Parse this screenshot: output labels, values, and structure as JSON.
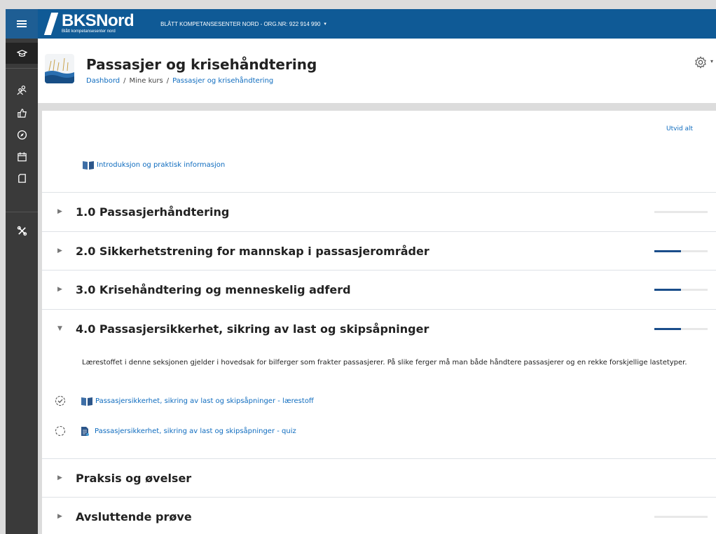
{
  "navbar": {
    "logo_main": "BKSNord",
    "logo_sub": "Blått kompetansesenter nord",
    "org_label": "BLÅTT KOMPETANSESENTER NORD - ORG.NR: 922 914 990",
    "org_caret": "▾"
  },
  "sidebar": {
    "icons": [
      "menu-icon",
      "course-icon",
      "participants-icon",
      "badges-icon",
      "competencies-icon",
      "calendar-icon",
      "files-icon",
      "tools-icon"
    ]
  },
  "header": {
    "title": "Passasjer og krisehåndtering",
    "breadcrumb": [
      "Dashbord",
      "Mine kurs",
      "Passasjer og krisehåndtering"
    ],
    "breadcrumb_sep": "/",
    "settings_caret": "▾"
  },
  "content": {
    "expand_all": "Utvid alt",
    "intro_link": "Introduksjon og praktisk informasjon",
    "sections": [
      {
        "title": "1.0 Passasjerhåndtering",
        "progress": 0,
        "caret": "▶"
      },
      {
        "title": "2.0 Sikkerhetstrening for mannskap i passasjerområder",
        "progress": 0.5,
        "caret": "▶"
      },
      {
        "title": "3.0 Krisehåndtering og menneskelig adferd",
        "progress": 0.5,
        "caret": "▶"
      },
      {
        "title": "4.0 Passasjersikkerhet, sikring av last og skipsåpninger",
        "progress": 0.5,
        "caret": "▼",
        "summary": "Lærestoffet i denne seksjonen gjelder i hovedsak for bilferger som frakter passasjerer. På slike ferger må man både håndtere passasjerer og en rekke forskjellige lastetyper.",
        "activities": [
          {
            "label": "Passasjersikkerhet, sikring av last og skipsåpninger - lærestoff",
            "complete": true
          },
          {
            "label": "Passasjersikkerhet, sikring av last og skipsåpninger - quiz",
            "complete": false
          }
        ]
      },
      {
        "title": "Praksis og øvelser",
        "caret": "▶"
      },
      {
        "title": "Avsluttende prøve",
        "progress": 0,
        "caret": "▶"
      }
    ]
  },
  "colors": {
    "navbar": "#0f5a96",
    "link": "#0f6cbf",
    "progress": "#1a4d8a"
  }
}
